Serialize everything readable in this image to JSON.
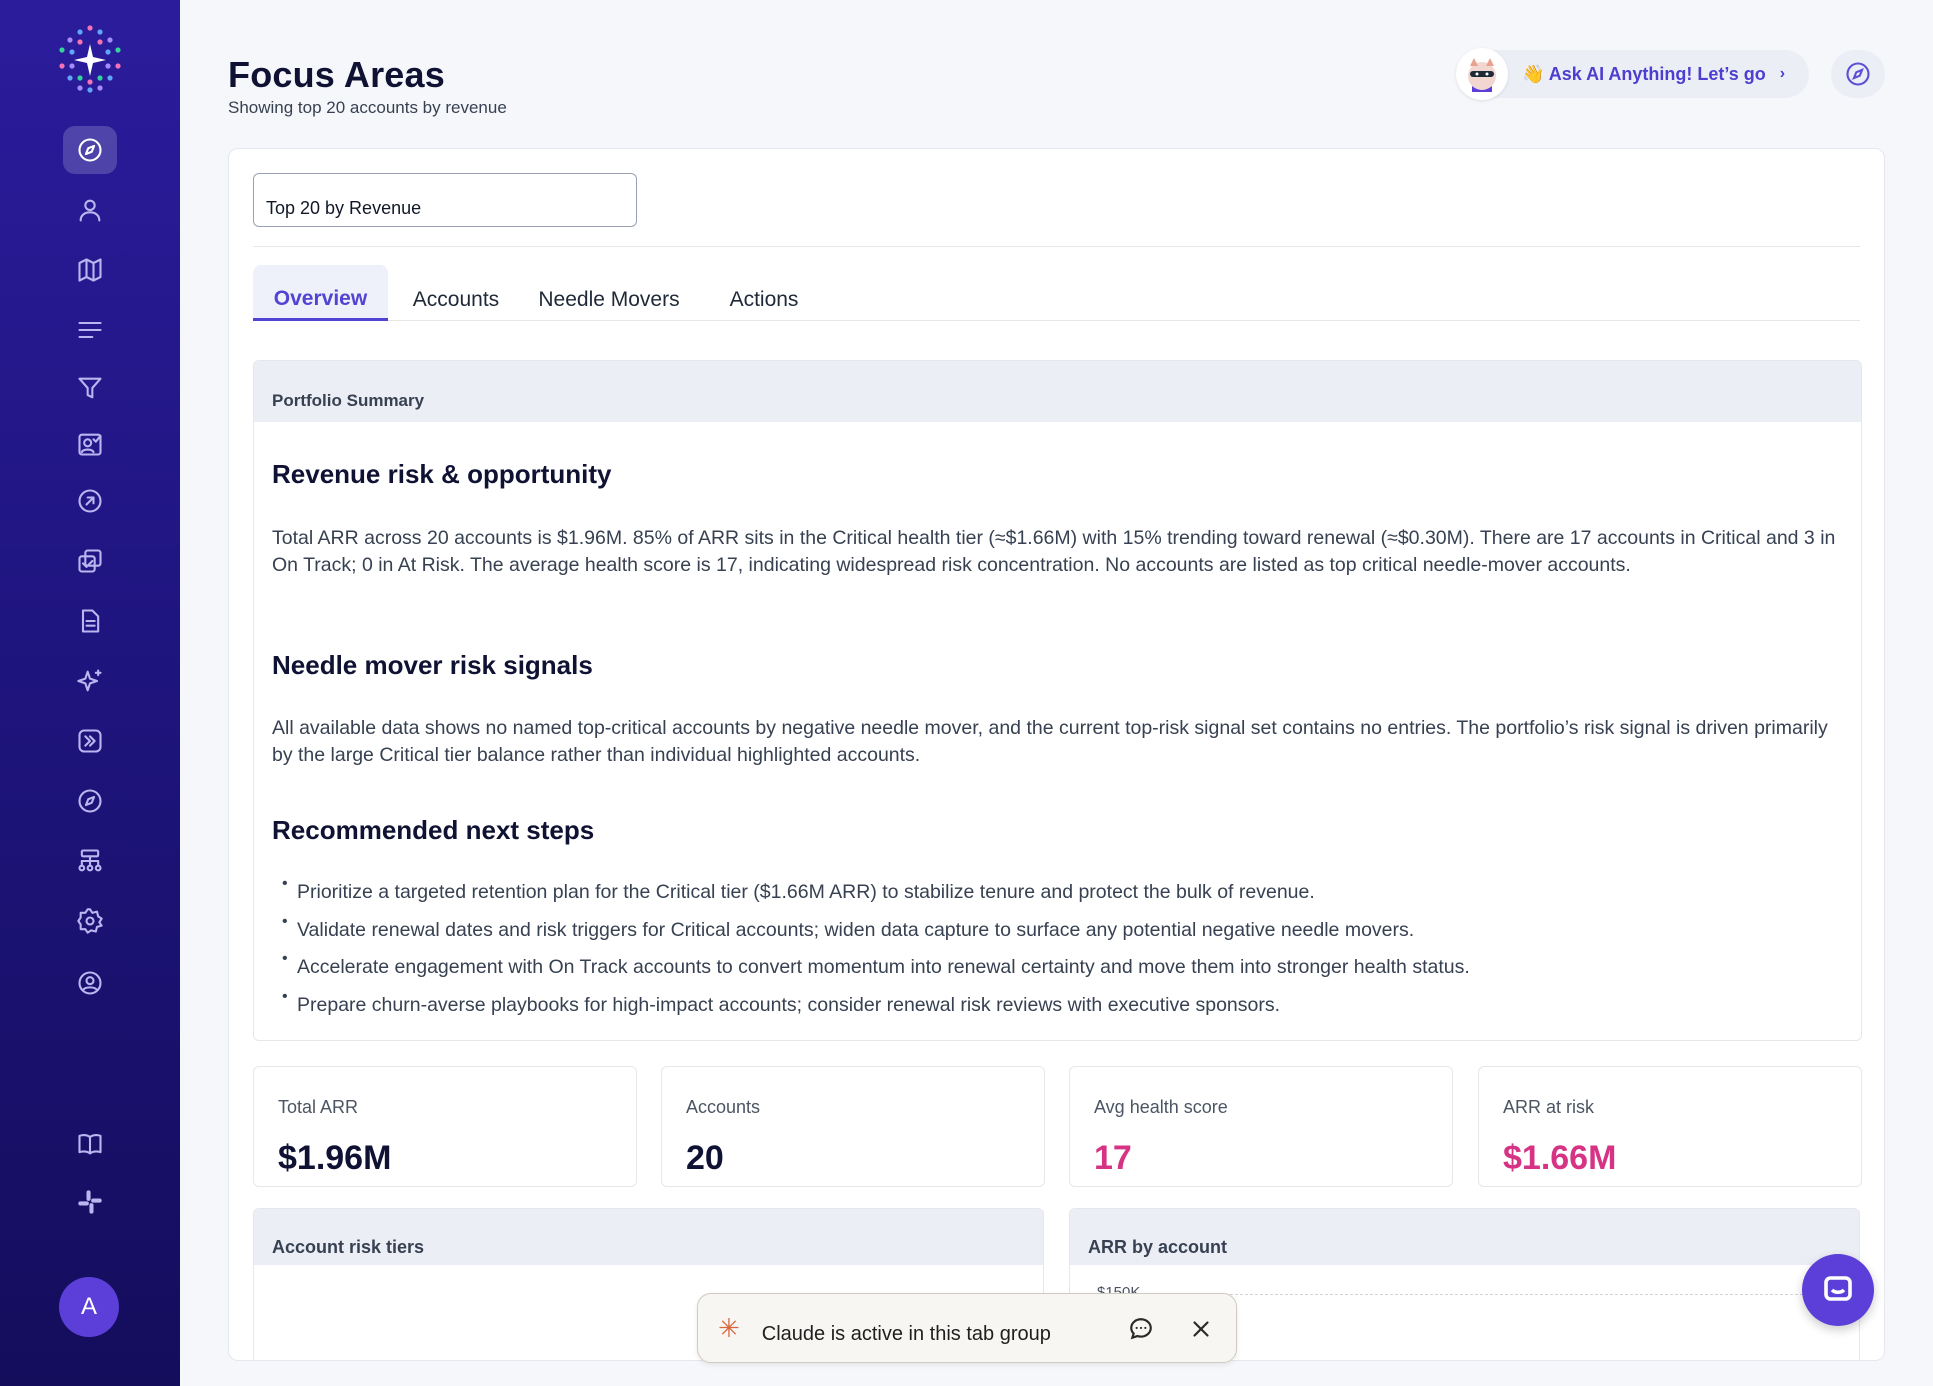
{
  "header": {
    "title": "Focus Areas",
    "subtitle": "Showing top 20 accounts by revenue",
    "ask_ai_label": "👋 Ask AI Anything! Let’s go"
  },
  "sidebar": {
    "avatar_initial": "A",
    "items": [
      "compass-icon",
      "user-icon",
      "map-icon",
      "list-icon",
      "filter-icon",
      "badge-check-icon",
      "arrow-up-right-circle-icon",
      "copy-check-icon",
      "document-icon",
      "sparkles-icon",
      "chevrons-right-icon",
      "compass-icon",
      "hierarchy-icon",
      "gear-icon",
      "user-circle-icon",
      "book-icon",
      "slack-icon"
    ]
  },
  "filter": {
    "selected": "Top 20 by Revenue"
  },
  "tabs": [
    {
      "label": "Overview"
    },
    {
      "label": "Accounts"
    },
    {
      "label": "Needle Movers"
    },
    {
      "label": "Actions"
    }
  ],
  "summary": {
    "header": "Portfolio Summary",
    "section1_title": "Revenue risk & opportunity",
    "section1_text": "Total ARR across 20 accounts is $1.96M. 85% of ARR sits in the Critical health tier (≈$1.66M) with 15% trending toward renewal (≈$0.30M). There are 17 accounts in Critical and 3 in On Track; 0 in At Risk. The average health score is 17, indicating widespread risk concentration. No accounts are listed as top critical needle-mover accounts.",
    "section2_title": "Needle mover risk signals",
    "section2_text": "All available data shows no named top-critical accounts by negative needle mover, and the current top-risk signal set contains no entries. The portfolio’s risk signal is driven primarily by the large Critical tier balance rather than individual highlighted accounts.",
    "section3_title": "Recommended next steps",
    "steps": [
      "Prioritize a targeted retention plan for the Critical tier ($1.66M ARR) to stabilize tenure and protect the bulk of revenue.",
      "Validate renewal dates and risk triggers for Critical accounts; widen data capture to surface any potential negative needle movers.",
      "Accelerate engagement with On Track accounts to convert momentum into renewal certainty and move them into stronger health status.",
      "Prepare churn-averse playbooks for high-impact accounts; consider renewal risk reviews with executive sponsors."
    ]
  },
  "stats": [
    {
      "label": "Total ARR",
      "value": "$1.96M"
    },
    {
      "label": "Accounts",
      "value": "20"
    },
    {
      "label": "Avg health score",
      "value": "17"
    },
    {
      "label": "ARR at risk",
      "value": "$1.66M"
    }
  ],
  "panels": {
    "risk_tiers_title": "Account risk tiers",
    "arr_by_account_title": "ARR by account",
    "arr_tick_top": "$150K"
  },
  "toast": {
    "text": "Claude is active in this tab group"
  },
  "colors": {
    "accent": "#5144d3",
    "pink": "#d63384",
    "sidebar": "#1f1580"
  }
}
